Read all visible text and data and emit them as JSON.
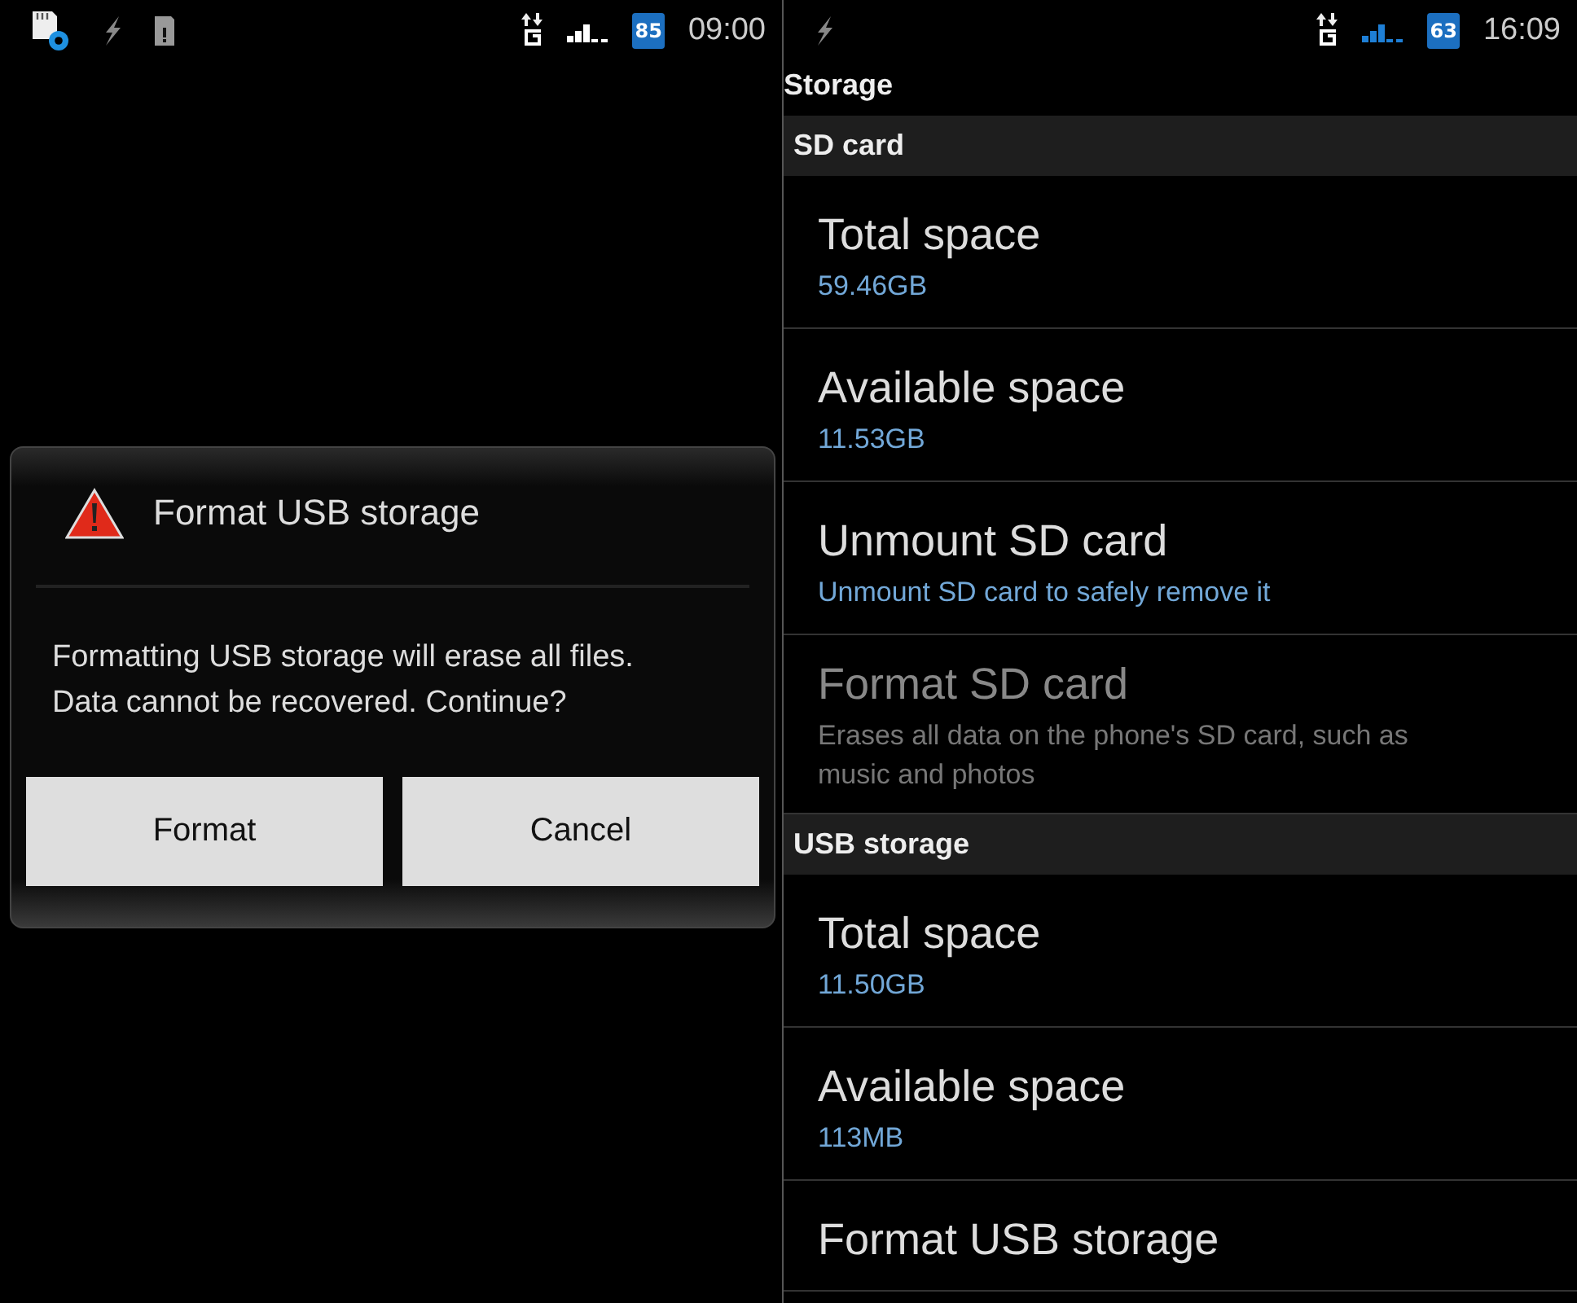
{
  "screens": [
    {
      "status_bar": {
        "notifications": [
          {
            "kind": "sd-settings"
          },
          {
            "kind": "charging"
          },
          {
            "kind": "sd-alert"
          }
        ],
        "signal": {
          "color": "#ffffff"
        },
        "battery": "85",
        "time": "09:00"
      },
      "dialog": {
        "title": "Format USB storage",
        "message": "Formatting USB storage will erase all files.\nData cannot be recovered. Continue?",
        "buttons": [
          "Format",
          "Cancel"
        ]
      }
    },
    {
      "status_bar": {
        "notifications": [
          {
            "kind": "charging"
          }
        ],
        "signal": {
          "color": "#1e7fd6"
        },
        "battery": "63",
        "time": "16:09"
      },
      "title": "Storage",
      "sections": [
        {
          "header": "SD card",
          "items": [
            {
              "title": "Total space",
              "summary": "59.46GB",
              "disabled": false
            },
            {
              "title": "Available space",
              "summary": "11.53GB",
              "disabled": false
            },
            {
              "title": "Unmount SD card",
              "summary": "Unmount SD card to safely remove it",
              "disabled": false
            },
            {
              "title": "Format SD card",
              "summary": "Erases all data on the phone's SD card, such as music and photos",
              "disabled": true
            }
          ]
        },
        {
          "header": "USB storage",
          "items": [
            {
              "title": "Total space",
              "summary": "11.50GB",
              "disabled": false
            },
            {
              "title": "Available space",
              "summary": "113MB",
              "disabled": false
            },
            {
              "title": "Format USB storage",
              "disabled": false
            }
          ]
        }
      ]
    }
  ]
}
